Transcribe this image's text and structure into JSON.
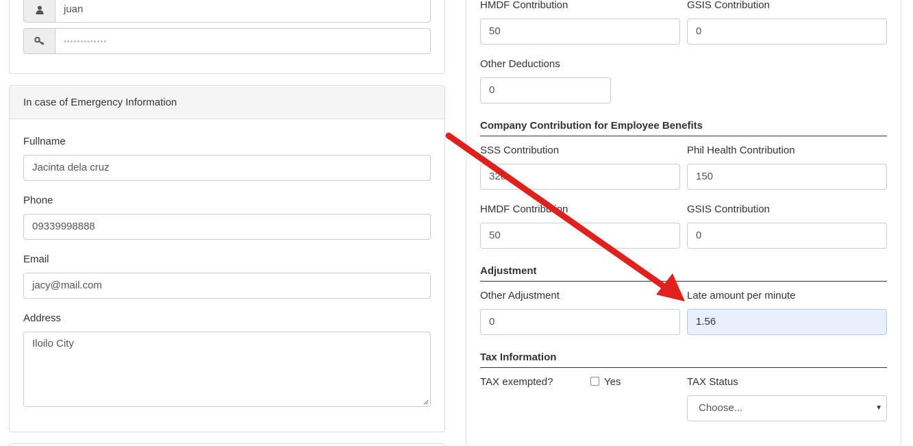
{
  "login": {
    "username_value": "juan",
    "password_placeholder": "•••••••••••••"
  },
  "emergency": {
    "title": "In case of Emergency Information",
    "fullname_label": "Fullname",
    "fullname_value": "Jacinta dela cruz",
    "phone_label": "Phone",
    "phone_value": "09339998888",
    "email_label": "Email",
    "email_value": "jacy@mail.com",
    "address_label": "Address",
    "address_value": "Iloilo City"
  },
  "employee_deductions": {
    "hmdf_label": "HMDF Contribution",
    "hmdf_value": "50",
    "gsis_label": "GSIS Contribution",
    "gsis_value": "0",
    "other_deductions_label": "Other Deductions",
    "other_deductions_value": "0"
  },
  "company_contribution": {
    "title": "Company Contribution for Employee Benefits",
    "sss_label": "SSS Contribution",
    "sss_value": "326",
    "philhealth_label": "Phil Health Contribution",
    "philhealth_value": "150",
    "hmdf_label": "HMDF Contribution",
    "hmdf_value": "50",
    "gsis_label": "GSIS Contribution",
    "gsis_value": "0"
  },
  "adjustment": {
    "title": "Adjustment",
    "other_label": "Other Adjustment",
    "other_value": "0",
    "late_label": "Late amount per minute",
    "late_value": "1.56"
  },
  "tax": {
    "title": "Tax Information",
    "exempted_label": "TAX exempted?",
    "yes_label": "Yes",
    "status_label": "TAX Status",
    "status_selected": "Choose..."
  },
  "colors": {
    "annotation_arrow": "#e0201c",
    "focused_input_bg": "#e8f0fe"
  },
  "icons": {
    "username_addon": "user-icon",
    "password_addon": "key-icon",
    "annotation": "red-arrow-annotation"
  }
}
